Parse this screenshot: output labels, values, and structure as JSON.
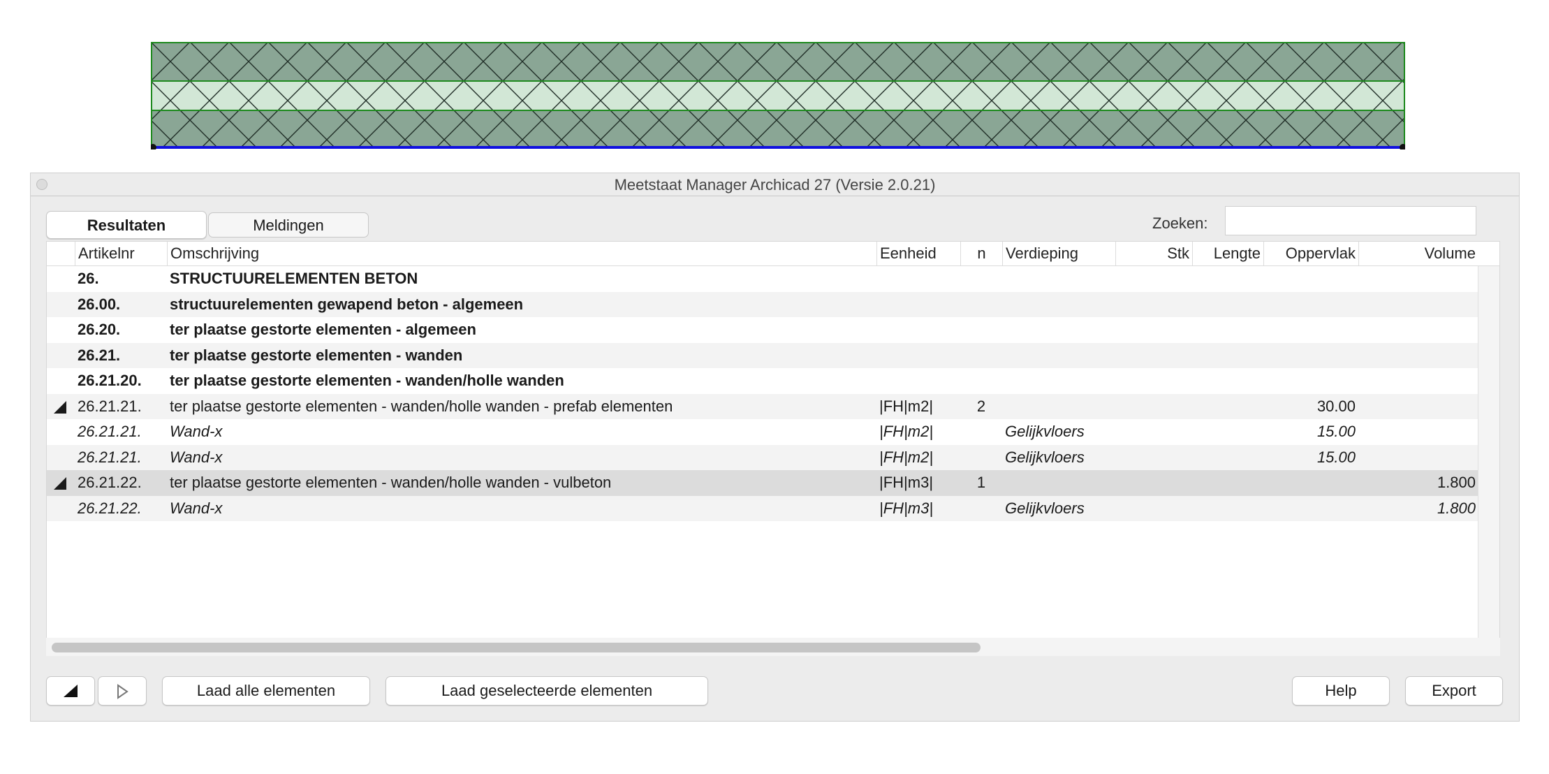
{
  "window": {
    "title": "Meetstaat Manager Archicad 27 (Versie 2.0.21)"
  },
  "tabs": [
    {
      "label": "Resultaten",
      "active": true
    },
    {
      "label": "Meldingen",
      "active": false
    }
  ],
  "search": {
    "label": "Zoeken:",
    "value": ""
  },
  "columns": [
    "Artikelnr",
    "Omschrijving",
    "Eenheid",
    "n",
    "Verdieping",
    "Stk",
    "Lengte",
    "Oppervlak",
    "Volume"
  ],
  "rows": [
    {
      "artikelnr": "26.",
      "omschrijving": "STRUCTUURELEMENTEN BETON",
      "eenheid": "",
      "n": "",
      "verdieping": "",
      "stk": "",
      "lengte": "",
      "oppervlak": "",
      "volume": "",
      "style": "bold",
      "expander": false
    },
    {
      "artikelnr": "26.00.",
      "omschrijving": "structuurelementen gewapend beton - algemeen",
      "eenheid": "",
      "n": "",
      "verdieping": "",
      "stk": "",
      "lengte": "",
      "oppervlak": "",
      "volume": "",
      "style": "bold",
      "expander": false
    },
    {
      "artikelnr": "26.20.",
      "omschrijving": "ter plaatse gestorte elementen - algemeen",
      "eenheid": "",
      "n": "",
      "verdieping": "",
      "stk": "",
      "lengte": "",
      "oppervlak": "",
      "volume": "",
      "style": "bold",
      "expander": false
    },
    {
      "artikelnr": "26.21.",
      "omschrijving": "ter plaatse gestorte elementen - wanden",
      "eenheid": "",
      "n": "",
      "verdieping": "",
      "stk": "",
      "lengte": "",
      "oppervlak": "",
      "volume": "",
      "style": "bold",
      "expander": false
    },
    {
      "artikelnr": "26.21.20.",
      "omschrijving": "ter plaatse gestorte elementen - wanden/holle wanden",
      "eenheid": "",
      "n": "",
      "verdieping": "",
      "stk": "",
      "lengte": "",
      "oppervlak": "",
      "volume": "",
      "style": "bold",
      "expander": false
    },
    {
      "artikelnr": "26.21.21.",
      "omschrijving": "ter plaatse gestorte elementen - wanden/holle wanden - prefab elementen",
      "eenheid": "|FH|m2|",
      "n": "2",
      "verdieping": "",
      "stk": "",
      "lengte": "",
      "oppervlak": "30.00",
      "volume": "",
      "style": "normal",
      "expander": true
    },
    {
      "artikelnr": "26.21.21.",
      "omschrijving": "Wand-x",
      "eenheid": "|FH|m2|",
      "n": "",
      "verdieping": "Gelijkvloers",
      "stk": "",
      "lengte": "",
      "oppervlak": "15.00",
      "volume": "",
      "style": "italic",
      "expander": false
    },
    {
      "artikelnr": "26.21.21.",
      "omschrijving": "Wand-x",
      "eenheid": "|FH|m2|",
      "n": "",
      "verdieping": "Gelijkvloers",
      "stk": "",
      "lengte": "",
      "oppervlak": "15.00",
      "volume": "",
      "style": "italic",
      "expander": false
    },
    {
      "artikelnr": "26.21.22.",
      "omschrijving": "ter plaatse gestorte elementen - wanden/holle wanden - vulbeton",
      "eenheid": "|FH|m3|",
      "n": "1",
      "verdieping": "",
      "stk": "",
      "lengte": "",
      "oppervlak": "",
      "volume": "1.800",
      "style": "normal",
      "expander": true,
      "selected": true
    },
    {
      "artikelnr": "26.21.22.",
      "omschrijving": "Wand-x",
      "eenheid": "|FH|m3|",
      "n": "",
      "verdieping": "Gelijkvloers",
      "stk": "",
      "lengte": "",
      "oppervlak": "",
      "volume": "1.800",
      "style": "italic",
      "expander": false
    }
  ],
  "buttons": {
    "collapse_icon": "collapse-triangle-icon",
    "expand_icon": "expand-triangle-icon",
    "load_all": "Laad alle elementen",
    "load_selected": "Laad geselecteerde elementen",
    "help": "Help",
    "export": "Export"
  },
  "colors": {
    "wall_dark": "#8aa695",
    "wall_light": "#d2e7d6",
    "wall_outline": "#1e8a1e",
    "wall_baseline": "#1010e0",
    "row_selected": "#dcdcdc",
    "row_alt": "#f3f3f3"
  }
}
